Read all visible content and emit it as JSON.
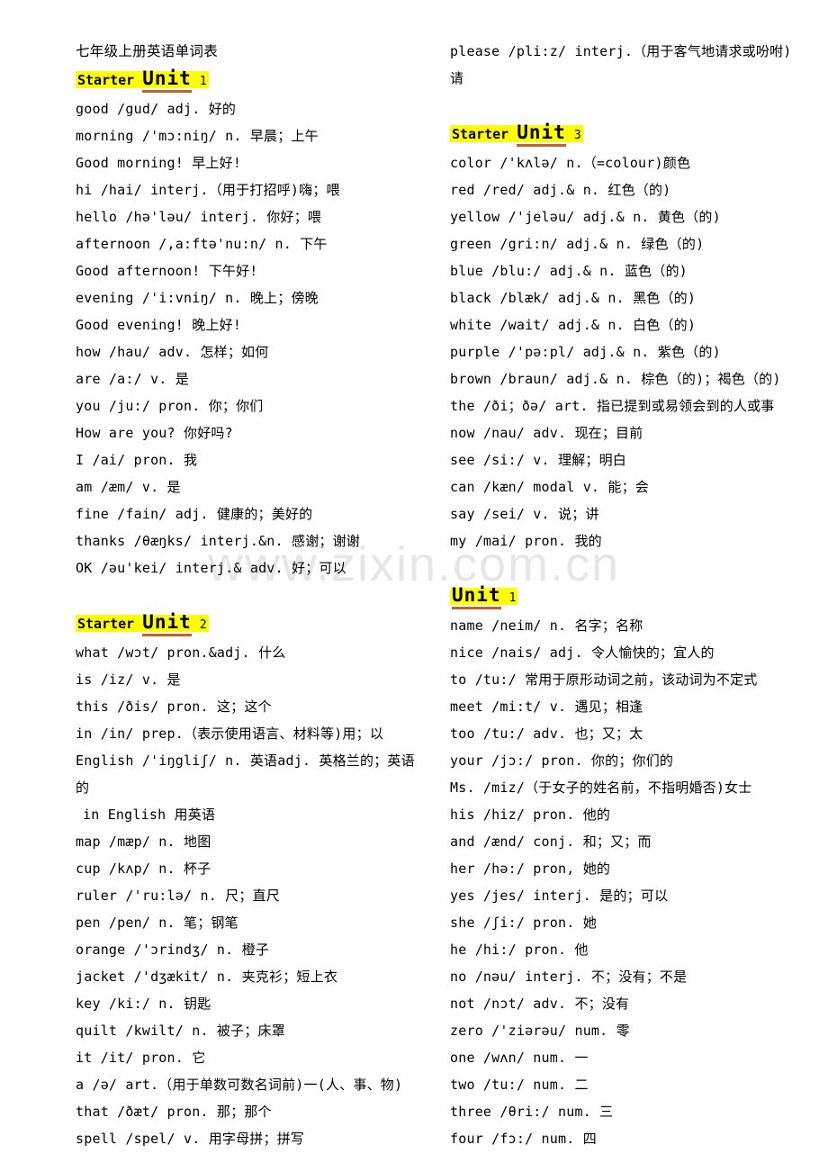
{
  "document": {
    "title": "七年级上册英语单词表",
    "watermark": "www.zixin.com.cn",
    "highlight_color": "#ffff00",
    "underline_color": "#c0622c"
  },
  "left_column": {
    "blocks": [
      {
        "type": "heading",
        "prefix": "Starter",
        "unit_word": "Unit",
        "number": "1"
      },
      {
        "type": "entry",
        "text": "good  /gud/ adj. 好的"
      },
      {
        "type": "entry",
        "text": "morning  /'mɔ:niŋ/ n. 早晨；上午"
      },
      {
        "type": "entry",
        "text": "Good morning! 早上好!"
      },
      {
        "type": "entry",
        "text": "hi  /hai/ interj.（用于打招呼)嗨；喂"
      },
      {
        "type": "entry",
        "text": "hello  /hə'ləu/ interj. 你好；喂"
      },
      {
        "type": "entry",
        "text": "afternoon  /,a:ftə'nu:n/ n. 下午"
      },
      {
        "type": "entry",
        "text": "Good afternoon! 下午好!"
      },
      {
        "type": "entry",
        "text": "evening  /'i:vniŋ/ n. 晚上；傍晚"
      },
      {
        "type": "entry",
        "text": "Good evening! 晚上好!"
      },
      {
        "type": "entry",
        "text": "how  /hau/ adv. 怎样；如何"
      },
      {
        "type": "entry",
        "text": "are  /a:/ v. 是"
      },
      {
        "type": "entry",
        "text": "you  /ju:/ pron. 你；你们"
      },
      {
        "type": "entry",
        "text": "How are you? 你好吗?"
      },
      {
        "type": "entry",
        "text": "I  /ai/ pron. 我"
      },
      {
        "type": "entry",
        "text": "am  /æm/ v. 是"
      },
      {
        "type": "entry",
        "text": "fine  /fain/ adj. 健康的；美好的"
      },
      {
        "type": "entry",
        "text": "thanks  /θæŋks/ interj.&n. 感谢；谢谢"
      },
      {
        "type": "entry",
        "text": "OK  /əu'kei/ interj.& adv. 好；可以"
      },
      {
        "type": "gap"
      },
      {
        "type": "heading",
        "prefix": "Starter",
        "unit_word": "Unit",
        "number": "2"
      },
      {
        "type": "entry",
        "text": "what  /wɔt/ pron.&adj. 什么"
      },
      {
        "type": "entry",
        "text": "is  /iz/ v. 是"
      },
      {
        "type": "entry",
        "text": "this  /ðis/ pron. 这；这个"
      },
      {
        "type": "entry",
        "text": "in  /in/ prep.（表示使用语言、材料等)用；以"
      },
      {
        "type": "entry_wrap",
        "text": "English  /'iŋgliʃ/ n. 英语adj. 英格兰的；英语",
        "cont": "的"
      },
      {
        "type": "entry_indent",
        "text": "in English 用英语"
      },
      {
        "type": "entry",
        "text": "map  /mæp/ n. 地图"
      },
      {
        "type": "entry",
        "text": "cup  /kʌp/ n. 杯子"
      },
      {
        "type": "entry",
        "text": "ruler  /'ru:lə/ n. 尺；直尺"
      },
      {
        "type": "entry",
        "text": "pen  /pen/ n. 笔；钢笔"
      },
      {
        "type": "entry",
        "text": "orange  /'ɔrindʒ/ n. 橙子"
      },
      {
        "type": "entry",
        "text": "jacket  /'dʒækit/ n. 夹克衫；短上衣"
      },
      {
        "type": "entry",
        "text": "key  /ki:/ n. 钥匙"
      },
      {
        "type": "entry",
        "text": "quilt /kwilt/ n. 被子；床罩"
      },
      {
        "type": "entry",
        "text": "it  /it/ pron. 它"
      },
      {
        "type": "entry",
        "text": "a  /ə/ art.（用于单数可数名词前)一(人、事、物)"
      },
      {
        "type": "entry",
        "text": "that  /ðæt/ pron. 那；那个"
      },
      {
        "type": "entry",
        "text": "spell  /spel/ v. 用字母拼；拼写"
      }
    ]
  },
  "right_column": {
    "blocks": [
      {
        "type": "entry_wrap",
        "text": "please  /pli:z/ interj.（用于客气地请求或吩咐)",
        "cont": "请"
      },
      {
        "type": "gap"
      },
      {
        "type": "heading",
        "prefix": "Starter",
        "unit_word": "Unit",
        "number": "3"
      },
      {
        "type": "entry",
        "text": "color  /'kʌlə/ n.（=colour)颜色"
      },
      {
        "type": "entry",
        "text": "red  /red/ adj.& n. 红色（的)"
      },
      {
        "type": "entry",
        "text": "yellow  /'jeləu/ adj.& n. 黄色（的)"
      },
      {
        "type": "entry",
        "text": "green  /gri:n/ adj.& n. 绿色（的)"
      },
      {
        "type": "entry",
        "text": "blue  /blu:/ adj.& n. 蓝色（的)"
      },
      {
        "type": "entry",
        "text": "black  /blæk/ adj.& n. 黑色（的)"
      },
      {
        "type": "entry",
        "text": "white  /wait/ adj.& n. 白色（的)"
      },
      {
        "type": "entry",
        "text": "purple  /'pə:pl/ adj.& n. 紫色（的)"
      },
      {
        "type": "entry",
        "text": "brown  /braun/ adj.& n. 棕色（的)；褐色（的)"
      },
      {
        "type": "entry",
        "text": "the  /ði；ðə/ art. 指已提到或易领会到的人或事"
      },
      {
        "type": "entry",
        "text": "now  /nau/ adv. 现在；目前"
      },
      {
        "type": "entry",
        "text": "see  /si:/ v. 理解；明白"
      },
      {
        "type": "entry",
        "text": "can  /kæn/ modal v. 能；会"
      },
      {
        "type": "entry",
        "text": "say  /sei/ v. 说；讲"
      },
      {
        "type": "entry",
        "text": "my  /mai/ pron. 我的"
      },
      {
        "type": "gap"
      },
      {
        "type": "heading",
        "prefix": "",
        "unit_word": "Unit",
        "number": "1"
      },
      {
        "type": "entry",
        "text": "name  /neim/ n. 名字；名称"
      },
      {
        "type": "entry",
        "text": "nice  /nais/ adj. 令人愉快的；宜人的"
      },
      {
        "type": "entry",
        "text": "to  /tu:/ 常用于原形动词之前，该动词为不定式"
      },
      {
        "type": "entry",
        "text": "meet  /mi:t/ v. 遇见；相逢"
      },
      {
        "type": "entry",
        "text": "too  /tu:/ adv. 也；又；太"
      },
      {
        "type": "entry",
        "text": "your  /jɔ:/ pron. 你的；你们的"
      },
      {
        "type": "entry",
        "text": "Ms. /miz/（于女子的姓名前，不指明婚否)女士"
      },
      {
        "type": "entry",
        "text": "his  /hiz/ pron. 他的"
      },
      {
        "type": "entry",
        "text": "and  /ænd/ conj. 和；又；而"
      },
      {
        "type": "entry",
        "text": "her  /hə:/ pron, 她的"
      },
      {
        "type": "entry",
        "text": "yes  /jes/ interj. 是的；可以"
      },
      {
        "type": "entry",
        "text": "she  /ʃi:/ pron. 她"
      },
      {
        "type": "entry",
        "text": "he  /hi:/ pron. 他"
      },
      {
        "type": "entry",
        "text": "no  /nəu/ interj. 不；没有；不是"
      },
      {
        "type": "entry",
        "text": "not  /nɔt/ adv. 不；没有"
      },
      {
        "type": "entry",
        "text": "zero  /'ziərəu/ num. 零"
      },
      {
        "type": "entry",
        "text": "one  /wʌn/ num. 一"
      },
      {
        "type": "entry",
        "text": "two  /tu:/ num. 二"
      },
      {
        "type": "entry",
        "text": "three  /θri:/ num. 三"
      },
      {
        "type": "entry",
        "text": "four  /fɔ:/ num. 四"
      }
    ]
  }
}
